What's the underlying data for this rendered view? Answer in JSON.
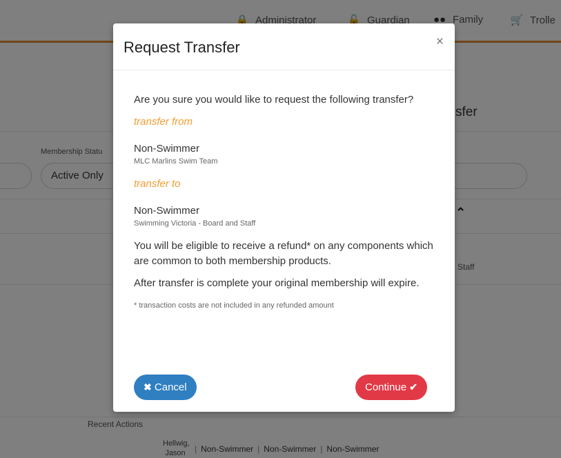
{
  "nav": {
    "administrator": "Administrator",
    "guardian": "Guardian",
    "family": "Family",
    "trolley": "Trolle"
  },
  "background": {
    "heading_fragment": "sfer",
    "membership_status_label": "Membership Statu",
    "active_only": "Active Only",
    "staff_fragment": "Staff",
    "recent_actions": "Recent Actions",
    "row": {
      "name": "Hellwig, Jason",
      "cells": [
        "Non-Swimmer",
        "Non-Swimmer",
        "Non-Swimmer"
      ]
    }
  },
  "modal": {
    "title": "Request Transfer",
    "close": "×",
    "question": "Are you sure you would like to request the following transfer?",
    "from_label": "transfer from",
    "from_product": "Non-Swimmer",
    "from_org": "MLC Marlins Swim Team",
    "to_label": "transfer to",
    "to_product": "Non-Swimmer",
    "to_org": "Swimming Victoria - Board and Staff",
    "refund_text": "You will be eligible to receive a refund* on any components which are common to both membership products.",
    "expire_text": "After transfer is complete your original membership will expire.",
    "footnote": "* transaction costs are not included in any refunded amount",
    "cancel_label": "Cancel",
    "continue_label": "Continue"
  },
  "icons": {
    "administrator": "user-lock-icon",
    "guardian": "unlock-icon",
    "family": "users-icon",
    "trolley": "cart-icon",
    "cancel": "times-icon",
    "continue": "check-icon"
  },
  "colors": {
    "nav_rule": "#e58a2e",
    "section_label": "#f39c30",
    "cancel_button": "#2f7fc1",
    "continue_button": "#e23947"
  }
}
